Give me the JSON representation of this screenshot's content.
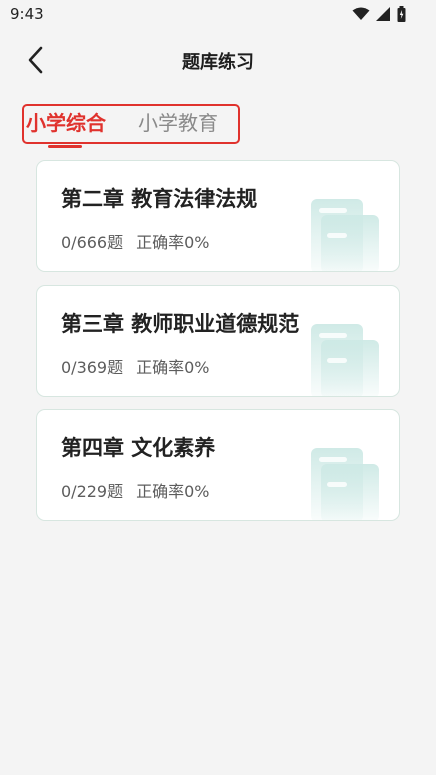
{
  "status_bar": {
    "time": "9:43"
  },
  "header": {
    "title": "题库练习"
  },
  "tabs": [
    {
      "label": "小学综合",
      "active": true
    },
    {
      "label": "小学教育",
      "active": false
    }
  ],
  "chapters": [
    {
      "title": "第二章 教育法律法规",
      "count": "0/666题",
      "accuracy": "正确率0%"
    },
    {
      "title": "第三章 教师职业道德规范",
      "count": "0/369题",
      "accuracy": "正确率0%"
    },
    {
      "title": "第四章 文化素养",
      "count": "0/229题",
      "accuracy": "正确率0%"
    }
  ],
  "colors": {
    "accent": "#e0322d",
    "inactive_tab": "#8a8a8a",
    "card_border": "#d7e6e0",
    "illustration": "#cde9e5"
  },
  "icons": [
    "wifi-icon",
    "signal-icon",
    "battery-icon",
    "back-arrow-icon",
    "document-icon"
  ]
}
